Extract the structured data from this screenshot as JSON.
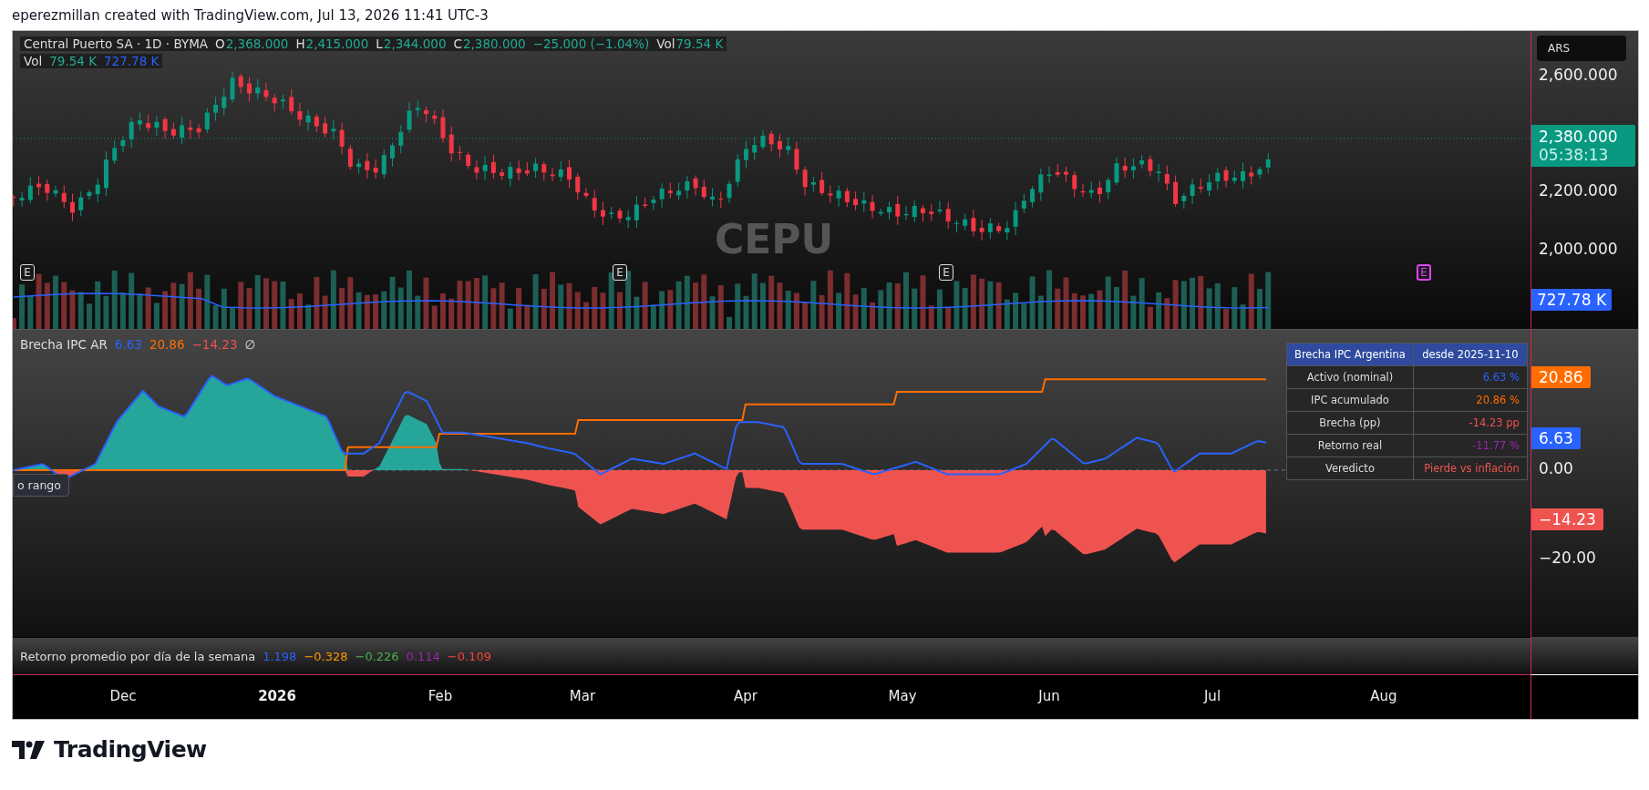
{
  "attribution": "eperezmillan created with TradingView.com, Jul 13, 2026 11:41 UTC-3",
  "main_pane": {
    "legend": {
      "symbol": "Central Puerto SA · 1D · BYMA",
      "ohlc": [
        {
          "label": "O",
          "value": "2,368.000"
        },
        {
          "label": "H",
          "value": "2,415.000"
        },
        {
          "label": "L",
          "value": "2,344.000"
        },
        {
          "label": "C",
          "value": "2,380.000"
        }
      ],
      "change": "−25.000 (−1.04%)",
      "volume": {
        "label": "Vol",
        "value": "79.54 K"
      }
    },
    "volume_legend": {
      "label": "Vol",
      "values": [
        {
          "text": "79.54 K",
          "color": "#22ab94"
        },
        {
          "text": "727.78 K",
          "color": "#2962ff"
        }
      ]
    },
    "symbol_watermark": "CEPU",
    "earnings_markers": [
      {
        "label": "E",
        "kind": "reported"
      },
      {
        "label": "E",
        "kind": "reported"
      },
      {
        "label": "E",
        "kind": "reported"
      },
      {
        "label": "E",
        "kind": "upcoming"
      }
    ],
    "price_axis": {
      "currency": "ARS",
      "ticks": [
        "2,600.000",
        "2,200.000",
        "2,000.000"
      ],
      "last_price": "2,380.000",
      "countdown": "05:38:13",
      "volume_tag": "727.78 K"
    }
  },
  "indicator_pane": {
    "legend": {
      "name": "Brecha IPC AR",
      "values": [
        {
          "text": "6.63",
          "color": "#2962ff"
        },
        {
          "text": "20.86",
          "color": "#ff6d00"
        },
        {
          "text": "−14.23",
          "color": "#ef5350"
        }
      ],
      "status_icon": "∅"
    },
    "tooltip": "o rango",
    "table": {
      "header": [
        "Brecha IPC Argentina",
        "desde 2025-11-10"
      ],
      "rows": [
        {
          "label": "Activo (nominal)",
          "value": "6.63 %",
          "color": "#2962ff"
        },
        {
          "label": "IPC acumulado",
          "value": "20.86 %",
          "color": "#ff6d00"
        },
        {
          "label": "Brecha (pp)",
          "value": "-14.23 pp",
          "color": "#ef5350"
        },
        {
          "label": "Retorno real",
          "value": "-11.77 %",
          "color": "#9c27b0"
        },
        {
          "label": "Veredicto",
          "value": "Pierde vs inflación",
          "color": "#ef5350"
        }
      ]
    },
    "axis": [
      {
        "text": "20.86",
        "kind": "tag",
        "color": "#ff6d00"
      },
      {
        "text": "6.63",
        "kind": "tag",
        "color": "#2962ff"
      },
      {
        "text": "0.00",
        "kind": "tick"
      },
      {
        "text": "−14.23",
        "kind": "tag",
        "color": "#ef5350"
      },
      {
        "text": "−20.00",
        "kind": "tick"
      }
    ]
  },
  "weekday_pane": {
    "title": "Retorno promedio por día de la semana",
    "values": [
      {
        "text": "1.198",
        "color": "#2962ff"
      },
      {
        "text": "−0.328",
        "color": "#ff9800"
      },
      {
        "text": "−0.226",
        "color": "#4caf50"
      },
      {
        "text": "0.114",
        "color": "#9c27b0"
      },
      {
        "text": "−0.109",
        "color": "#f44336"
      }
    ]
  },
  "time_axis": [
    {
      "label": "Dec",
      "kind": "month"
    },
    {
      "label": "2026",
      "kind": "year"
    },
    {
      "label": "Feb",
      "kind": "month"
    },
    {
      "label": "Mar",
      "kind": "month"
    },
    {
      "label": "Apr",
      "kind": "month"
    },
    {
      "label": "May",
      "kind": "month"
    },
    {
      "label": "Jun",
      "kind": "month"
    },
    {
      "label": "Jul",
      "kind": "month"
    },
    {
      "label": "Aug",
      "kind": "month"
    }
  ],
  "brand": "TradingView"
}
